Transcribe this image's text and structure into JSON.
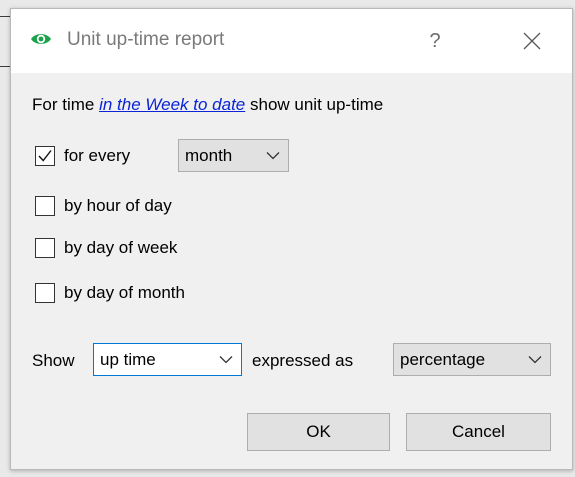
{
  "window": {
    "title": "Unit up-time report",
    "help_label": "?",
    "app_icon": "eye-icon",
    "accent_color": "#1aa34a"
  },
  "range_row": {
    "prefix": "For time",
    "link": "in the Week to date",
    "suffix": "show unit up-time"
  },
  "options": [
    {
      "label": "for every",
      "checked": true
    },
    {
      "label": "by hour of day",
      "checked": false
    },
    {
      "label": "by day of week",
      "checked": false
    },
    {
      "label": "by day of month",
      "checked": false
    }
  ],
  "period_select": {
    "value": "month"
  },
  "show_row": {
    "show_label": "Show",
    "metric_value": "up time",
    "expressed_label": "expressed as",
    "format_value": "percentage"
  },
  "buttons": {
    "ok": "OK",
    "cancel": "Cancel"
  }
}
